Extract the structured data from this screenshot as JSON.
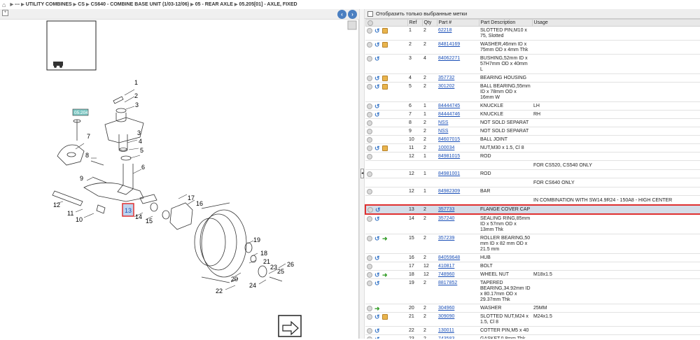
{
  "breadcrumb": {
    "items": [
      "---",
      "UTILITY COMBINES",
      "CS",
      "CS640 - COMBINE BASE UNIT (1/03-12/06)",
      "05 - REAR AXLE",
      "05.205[01] - AXLE, FIXED"
    ]
  },
  "filter_label": "Отобразить только выбранные метки",
  "columns": [
    "Ref",
    "Qty",
    "Part #",
    "Part Description",
    "Usage"
  ],
  "rows": [
    {
      "ref": "1",
      "qty": "2",
      "part": "62218",
      "desc": "SLOTTED PIN,M10 x 75, Slotted",
      "usage": "",
      "icons": [
        "circle",
        "arrow",
        "box"
      ]
    },
    {
      "ref": "2",
      "qty": "2",
      "part": "84814169",
      "desc": "WASHER,46mm ID x 75mm OD x 4mm Thk",
      "usage": "",
      "icons": [
        "circle",
        "arrow",
        "box"
      ]
    },
    {
      "ref": "3",
      "qty": "4",
      "part": "84062271",
      "desc": "BUSHING,52mm ID x 57H7mm OD x 40mm L",
      "usage": "",
      "icons": [
        "circle",
        "arrow"
      ]
    },
    {
      "ref": "4",
      "qty": "2",
      "part": "357732",
      "desc": "BEARING HOUSING",
      "usage": "",
      "icons": [
        "circle",
        "arrow",
        "box"
      ]
    },
    {
      "ref": "5",
      "qty": "2",
      "part": "301202",
      "desc": "BALL BEARING,55mm ID x 78mm OD x 16mm W",
      "usage": "",
      "icons": [
        "circle",
        "arrow",
        "box"
      ]
    },
    {
      "ref": "6",
      "qty": "1",
      "part": "84444745",
      "desc": "KNUCKLE",
      "usage": "LH",
      "icons": [
        "circle",
        "arrow"
      ]
    },
    {
      "ref": "7",
      "qty": "1",
      "part": "84444746",
      "desc": "KNUCKLE",
      "usage": "RH",
      "icons": [
        "circle",
        "arrow"
      ]
    },
    {
      "ref": "8",
      "qty": "2",
      "part": "NSS",
      "desc": "NOT SOLD SEPARAT",
      "usage": "",
      "icons": [
        "circle"
      ]
    },
    {
      "ref": "9",
      "qty": "2",
      "part": "NSS",
      "desc": "NOT SOLD SEPARAT",
      "usage": "",
      "icons": [
        "circle"
      ]
    },
    {
      "ref": "10",
      "qty": "2",
      "part": "84607015",
      "desc": "BALL JOINT",
      "usage": "",
      "icons": [
        "circle"
      ]
    },
    {
      "ref": "11",
      "qty": "2",
      "part": "100034",
      "desc": "NUT,M30 x 1.5, Cl 8",
      "usage": "",
      "icons": [
        "circle",
        "arrow",
        "box"
      ]
    },
    {
      "ref": "12",
      "qty": "1",
      "part": "84981015",
      "desc": "ROD",
      "usage": "",
      "icons": [
        "circle"
      ]
    },
    {
      "note": "FOR CS520, CS540 ONLY"
    },
    {
      "ref": "12",
      "qty": "1",
      "part": "84981001",
      "desc": "ROD",
      "usage": "",
      "icons": [
        "circle"
      ]
    },
    {
      "note": "FOR CS640 ONLY"
    },
    {
      "ref": "12",
      "qty": "1",
      "part": "84982309",
      "desc": "BAR",
      "usage": "",
      "icons": [
        "circle"
      ]
    },
    {
      "note": "IN COMBINATION WITH SW14.9R24 - 150A8 - HIGH CENTER"
    },
    {
      "ref": "13",
      "qty": "2",
      "part": "357733",
      "desc": "FLANGE COVER CAP",
      "usage": "",
      "icons": [
        "circle",
        "arrow"
      ],
      "selected": true
    },
    {
      "ref": "14",
      "qty": "2",
      "part": "357240",
      "desc": "SEALING RING,85mm ID x 57mm OD x 13mm Thk",
      "usage": "",
      "icons": [
        "circle",
        "arrow"
      ]
    },
    {
      "ref": "15",
      "qty": "2",
      "part": "357239",
      "desc": "ROLLER BEARING,50 mm ID x 82 mm OD x 21.5 mm",
      "usage": "",
      "icons": [
        "circle",
        "arrow",
        "green"
      ]
    },
    {
      "ref": "16",
      "qty": "2",
      "part": "84059648",
      "desc": "HUB",
      "usage": "",
      "icons": [
        "circle",
        "arrow"
      ]
    },
    {
      "ref": "17",
      "qty": "12",
      "part": "410817",
      "desc": "BOLT",
      "usage": "",
      "icons": [
        "circle"
      ]
    },
    {
      "ref": "18",
      "qty": "12",
      "part": "748960",
      "desc": "WHEEL NUT",
      "usage": "M18x1.5",
      "icons": [
        "circle",
        "arrow",
        "green"
      ]
    },
    {
      "ref": "19",
      "qty": "2",
      "part": "8817852",
      "desc": "TAPERED BEARING,34.92mm ID x 80.17mm OD x 29.37mm Thk",
      "usage": "",
      "icons": [
        "circle",
        "arrow"
      ]
    },
    {
      "ref": "20",
      "qty": "2",
      "part": "304960",
      "desc": "WASHER",
      "usage": "25MM",
      "icons": [
        "circle",
        "green"
      ]
    },
    {
      "ref": "21",
      "qty": "2",
      "part": "309090",
      "desc": "SLOTTED NUT,M24 x 1.5, Cl 8",
      "usage": "M24x1.5",
      "icons": [
        "circle",
        "arrow",
        "box"
      ]
    },
    {
      "ref": "22",
      "qty": "2",
      "part": "130011",
      "desc": "COTTER PIN,M5 x 40",
      "usage": "",
      "icons": [
        "circle",
        "arrow"
      ]
    },
    {
      "ref": "23",
      "qty": "2",
      "part": "743583",
      "desc": "GASKET,0.8mm Thk",
      "usage": "",
      "icons": [
        "circle",
        "arrow"
      ]
    }
  ],
  "drawing": {
    "tag_label": "05.204",
    "callouts": [
      "1",
      "2",
      "3",
      "3",
      "4",
      "5",
      "6",
      "7",
      "8",
      "9",
      "10",
      "11",
      "12",
      "13",
      "14",
      "15",
      "16",
      "17",
      "18",
      "19",
      "20",
      "21",
      "22",
      "23",
      "24",
      "25",
      "26"
    ]
  }
}
